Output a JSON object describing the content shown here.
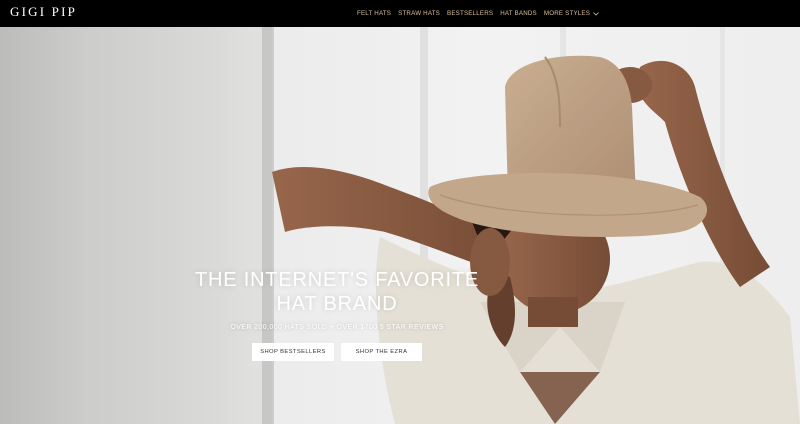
{
  "brand": {
    "name": "GIGI PIP"
  },
  "nav": {
    "items": [
      {
        "label": "FELT HATS"
      },
      {
        "label": "STRAW HATS"
      },
      {
        "label": "BESTSELLERS"
      },
      {
        "label": "HAT BANDS"
      },
      {
        "label": "MORE STYLES"
      }
    ]
  },
  "hero": {
    "title_line1": "THE INTERNET'S FAVORITE",
    "title_line2": "HAT BRAND",
    "subtitle": "OVER 200,000 HATS SOLD + OVER 1700 5 STAR REVIEWS",
    "buttons": [
      {
        "label": "SHOP BESTSELLERS"
      },
      {
        "label": "SHOP THE EZRA"
      }
    ]
  },
  "colors": {
    "header_bg": "#000000",
    "nav_text": "#d8c19a",
    "hat": "#c9ab8c",
    "skin": "#8f6048",
    "shirt": "#f3eee4"
  },
  "icons": {
    "more_styles": "chevron-down-icon"
  }
}
